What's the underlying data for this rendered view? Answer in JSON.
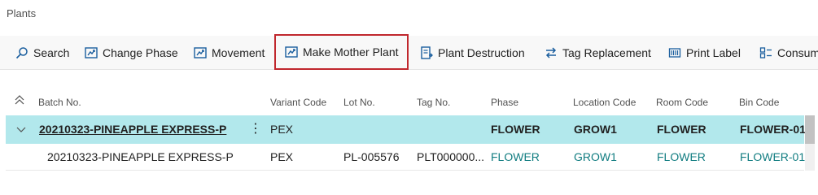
{
  "page": {
    "title": "Plants"
  },
  "actions": [
    {
      "label": "Search",
      "icon": "search-icon"
    },
    {
      "label": "Change Phase",
      "icon": "change-phase-icon"
    },
    {
      "label": "Movement",
      "icon": "movement-icon"
    },
    {
      "label": "Make Mother Plant",
      "icon": "make-mother-plant-icon",
      "highlighted": true
    },
    {
      "label": "Plant Destruction",
      "icon": "plant-destruction-icon"
    },
    {
      "label": "Tag Replacement",
      "icon": "tag-replacement-icon"
    },
    {
      "label": "Print Label",
      "icon": "print-label-icon"
    },
    {
      "label": "Consum",
      "icon": "consumption-icon"
    }
  ],
  "table": {
    "columns": [
      "Batch No.",
      "Variant Code",
      "Lot No.",
      "Tag No.",
      "Phase",
      "Location Code",
      "Room Code",
      "Bin Code"
    ],
    "rows": [
      {
        "batch_no": "20210323-PINEAPPLE EXPRESS-P",
        "variant_code": "PEX",
        "lot_no": "",
        "tag_no": "",
        "phase": "FLOWER",
        "location_code": "GROW1",
        "room_code": "FLOWER",
        "bin_code": "FLOWER-01",
        "expanded": true
      },
      {
        "batch_no": "20210323-PINEAPPLE EXPRESS-P",
        "variant_code": "PEX",
        "lot_no": "PL-005576",
        "tag_no": "PLT000000...",
        "phase": "FLOWER",
        "location_code": "GROW1",
        "room_code": "FLOWER",
        "bin_code": "FLOWER-01"
      }
    ]
  },
  "colors": {
    "accent": "#107c80",
    "selected_row": "#b2e8ec",
    "highlight_border": "#c0272d"
  }
}
